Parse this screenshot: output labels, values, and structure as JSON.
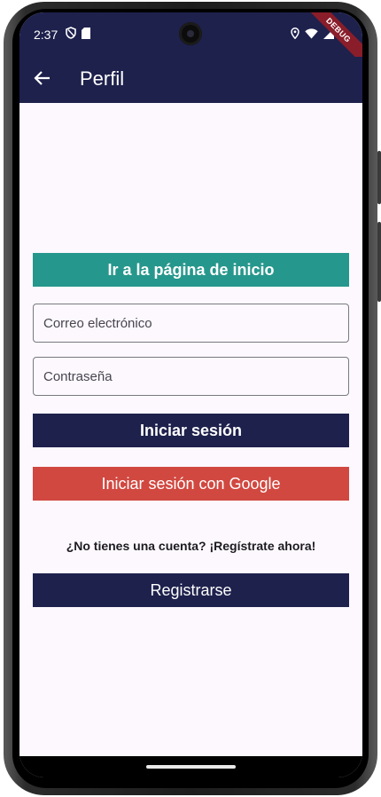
{
  "status_bar": {
    "time": "2:37",
    "left_icons": [
      "shield-icon",
      "sd-card-icon"
    ],
    "right_icons": [
      "location-icon",
      "wifi-icon",
      "signal-icon",
      "battery-icon"
    ],
    "debug_banner": "DEBUG"
  },
  "app_bar": {
    "back_icon": "arrow-back-icon",
    "title": "Perfil"
  },
  "main": {
    "home_button_label": "Ir a la página de inicio",
    "email_placeholder": "Correo electrónico",
    "password_placeholder": "Contraseña",
    "login_button_label": "Iniciar sesión",
    "google_button_label": "Iniciar sesión con Google",
    "signup_prompt": "¿No tienes una cuenta? ¡Regístrate ahora!",
    "register_button_label": "Registrarse"
  },
  "colors": {
    "app_bar": "#1e214c",
    "home_button": "#26978c",
    "google_button": "#d14840",
    "background": "#fcf8fe"
  }
}
